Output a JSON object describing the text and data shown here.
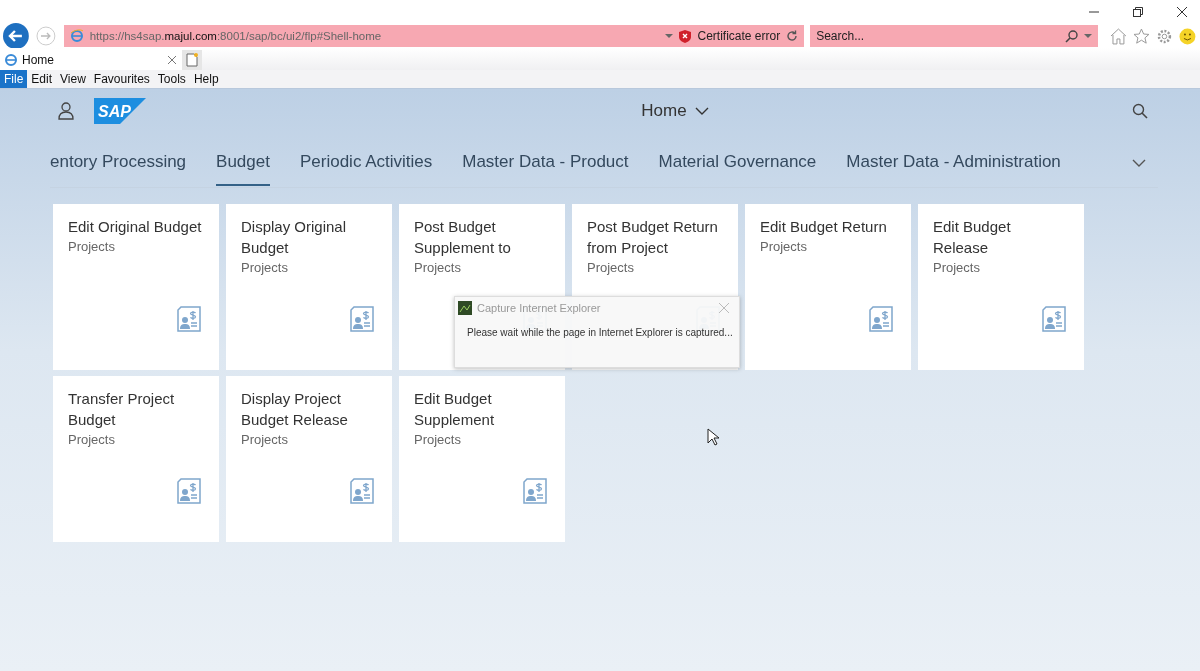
{
  "browser": {
    "address": "https://hs4sap.**majul.com**:8001/sap/bc/ui2/flp#Shell-home",
    "certificate_error": "Certificate error",
    "search": {
      "placeholder": "Search..."
    },
    "tab": {
      "title": "Home"
    },
    "menu": [
      {
        "label": "File",
        "selected": true
      },
      {
        "label": "Edit",
        "selected": false
      },
      {
        "label": "View",
        "selected": false
      },
      {
        "label": "Favourites",
        "selected": false
      },
      {
        "label": "Tools",
        "selected": false
      },
      {
        "label": "Help",
        "selected": false
      }
    ]
  },
  "shell": {
    "logo": "SAP",
    "title": "Home",
    "tabs": [
      {
        "label": "entory Processing",
        "selected": false
      },
      {
        "label": "Budget",
        "selected": true
      },
      {
        "label": "Periodic Activities",
        "selected": false
      },
      {
        "label": "Master Data - Product",
        "selected": false
      },
      {
        "label": "Material Governance",
        "selected": false
      },
      {
        "label": "Master Data - Administration",
        "selected": false
      }
    ],
    "tiles": [
      {
        "title": "Edit Original Budget",
        "subtitle": "Projects"
      },
      {
        "title": "Display Original Budget",
        "subtitle": "Projects"
      },
      {
        "title": "Post Budget Supplement to",
        "subtitle": "Projects"
      },
      {
        "title": "Post Budget Return from Project",
        "subtitle": "Projects"
      },
      {
        "title": "Edit Budget Return",
        "subtitle": "Projects"
      },
      {
        "title": "Edit Budget Release",
        "subtitle": "Projects"
      },
      {
        "title": "Transfer Project Budget",
        "subtitle": "Projects"
      },
      {
        "title": "Display Project Budget Release",
        "subtitle": "Projects"
      },
      {
        "title": "Edit Budget Supplement",
        "subtitle": "Projects"
      }
    ]
  },
  "popup": {
    "title": "Capture Internet Explorer",
    "message": "Please wait while the page in Internet Explorer is captured..."
  }
}
